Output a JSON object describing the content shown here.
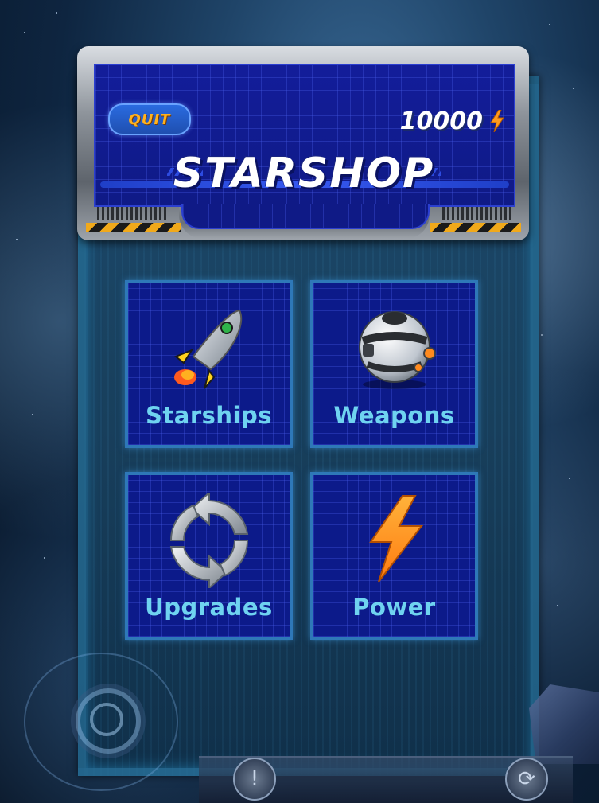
{
  "header": {
    "quit_label": "QUIT",
    "currency_amount": "10000",
    "currency_icon": "lightning-bolt-icon",
    "title": "STARSHOP"
  },
  "tiles": [
    {
      "label": "Starships",
      "icon": "rocket-icon"
    },
    {
      "label": "Weapons",
      "icon": "weapon-pod-icon"
    },
    {
      "label": "Upgrades",
      "icon": "refresh-arrows-icon"
    },
    {
      "label": "Power",
      "icon": "lightning-bolt-icon"
    }
  ],
  "colors": {
    "screen_blue": "#0f1a86",
    "tile_label": "#6fd3f0",
    "quit_text": "#ffb21e",
    "bolt_orange": "#ff9a1e",
    "tile_border": "#2e78b8"
  }
}
